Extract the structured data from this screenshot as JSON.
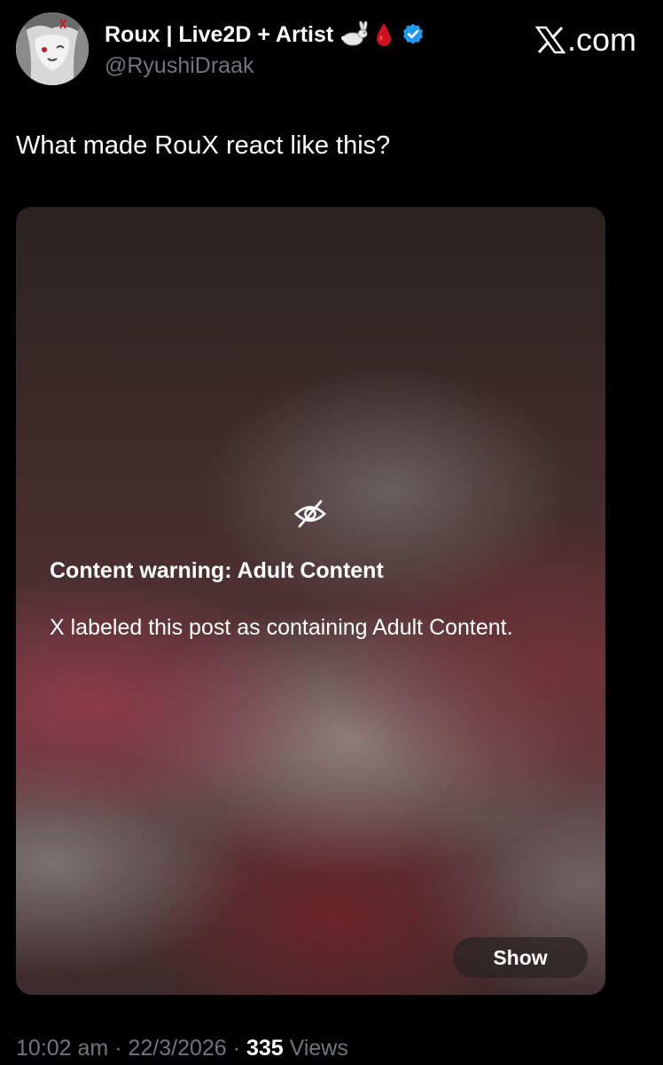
{
  "author": {
    "display_name": "Roux | Live2D + Artist",
    "handle": "@RyushiDraak",
    "name_emojis": [
      "rabbit-emoji",
      "blood-drop-emoji"
    ],
    "verified": true,
    "verified_color": "#1d9bf0"
  },
  "site": {
    "logo_icon": "x-logo-icon",
    "label": ".com"
  },
  "tweet": {
    "text": "What made RouX react like this?"
  },
  "media": {
    "icon": "eye-off-icon",
    "warning_title": "Content warning: Adult Content",
    "warning_description": "X labeled this post as containing Adult Content.",
    "show_label": "Show"
  },
  "meta": {
    "time": "10:02 am",
    "separator": "·",
    "date": "22/3/2026",
    "views_count": "335",
    "views_label": "Views"
  }
}
